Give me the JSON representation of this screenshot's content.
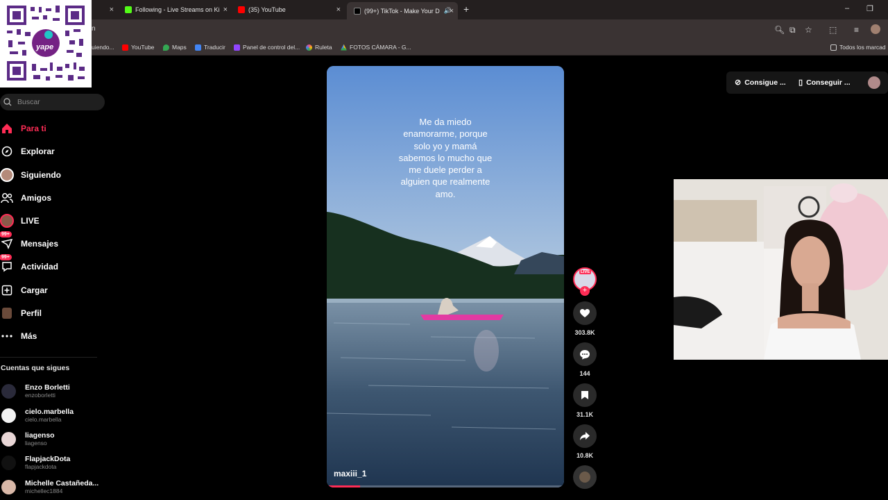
{
  "browser": {
    "tabs": [
      {
        "title": "",
        "close": "×"
      },
      {
        "title": "Following - Live Streams on Ki",
        "close": "×"
      },
      {
        "title": "(35) YouTube",
        "close": "×"
      },
      {
        "title": "(99+) TikTok - Make Your D",
        "close": "×"
      }
    ],
    "new_tab": "+",
    "window_controls": {
      "minimize": "–",
      "restore": "❐"
    },
    "address_fragment": "n",
    "bookmarks": [
      {
        "label": "uiendo...",
        "color": "#777777"
      },
      {
        "label": "YouTube",
        "color": "#ff0000"
      },
      {
        "label": "Maps",
        "color": "#34a853"
      },
      {
        "label": "Traducir",
        "color": "#4285f4"
      },
      {
        "label": "Panel de control del...",
        "color": "#9146ff"
      },
      {
        "label": "Ruleta",
        "color": "#e94b8a"
      },
      {
        "label": "FOTOS CÁMARA - G...",
        "color": "#fbbc04"
      }
    ],
    "bookmarks_all": "Todos los marcad"
  },
  "qr": {
    "brand_text": "yape"
  },
  "sidebar": {
    "search_placeholder": "Buscar",
    "nav": [
      {
        "label": "Para ti",
        "icon": "home-icon",
        "active": true
      },
      {
        "label": "Explorar",
        "icon": "compass-icon"
      },
      {
        "label": "Siguiendo",
        "icon": "following-avatar-icon"
      },
      {
        "label": "Amigos",
        "icon": "friends-icon"
      },
      {
        "label": "LIVE",
        "icon": "live-avatar-icon"
      },
      {
        "label": "Mensajes",
        "icon": "messages-icon",
        "badge": "99+"
      },
      {
        "label": "Actividad",
        "icon": "activity-icon",
        "badge": "99+"
      },
      {
        "label": "Cargar",
        "icon": "upload-icon"
      },
      {
        "label": "Perfil",
        "icon": "profile-icon"
      },
      {
        "label": "Más",
        "icon": "more-icon"
      }
    ],
    "following_title": "Cuentas que sigues",
    "accounts": [
      {
        "name": "Enzo Borletti",
        "handle": "enzoborletti"
      },
      {
        "name": "cielo.marbella",
        "handle": "cielo.marbella"
      },
      {
        "name": "liagenso",
        "handle": "liagenso"
      },
      {
        "name": "FlapjackDota",
        "handle": "flapjackdota"
      },
      {
        "name": "Michelle Castañeda...",
        "handle": "michellec1884"
      }
    ]
  },
  "video": {
    "caption": "Me da miedo enamorarme, porque solo yo y mamá sabemos lo mucho que me duele perder a alguien que realmente amo.",
    "author": "maxiii_1",
    "progress": 0.14
  },
  "actions": {
    "live_badge": "LIVE",
    "likes": "303.8K",
    "comments": "144",
    "saves": "31.1K",
    "shares": "10.8K"
  },
  "top_buttons": {
    "get_coins": "Consigue ...",
    "get_app": "Conseguir ..."
  },
  "colors": {
    "accent": "#fe2c55",
    "chrome": "#3a3333",
    "background": "#000000"
  }
}
